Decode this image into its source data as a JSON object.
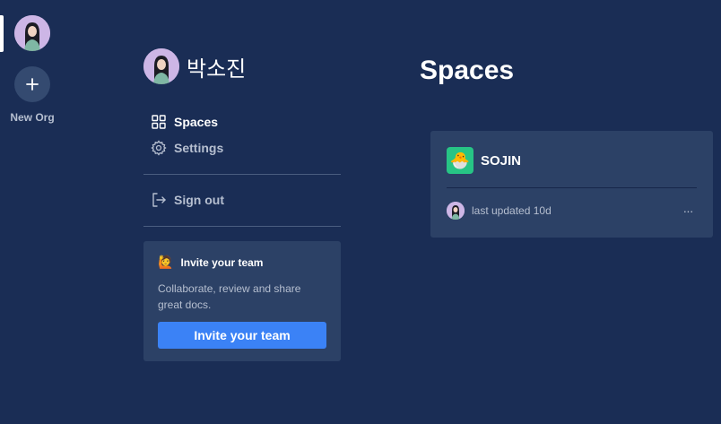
{
  "rail": {
    "new_org_label": "New Org"
  },
  "profile": {
    "name": "박소진"
  },
  "nav": {
    "spaces_label": "Spaces",
    "settings_label": "Settings",
    "signout_label": "Sign out"
  },
  "invite": {
    "emoji": "🙋",
    "title": "Invite your team",
    "description": "Collaborate, review and share great docs.",
    "button_label": "Invite your team"
  },
  "main": {
    "title": "Spaces",
    "spaces": [
      {
        "icon": "🐣",
        "name": "SOJIN",
        "updated": "last updated 10d",
        "more": "···"
      }
    ]
  },
  "colors": {
    "background": "#1a2d55",
    "card": "#2c4166",
    "accent": "#3b82f6",
    "space_icon_bg": "#27c485"
  },
  "icons": [
    "plus-icon",
    "grid-icon",
    "gear-icon",
    "sign-out-icon",
    "raising-hand-emoji-icon",
    "hatching-chick-emoji-icon",
    "more-horizontal-icon"
  ]
}
